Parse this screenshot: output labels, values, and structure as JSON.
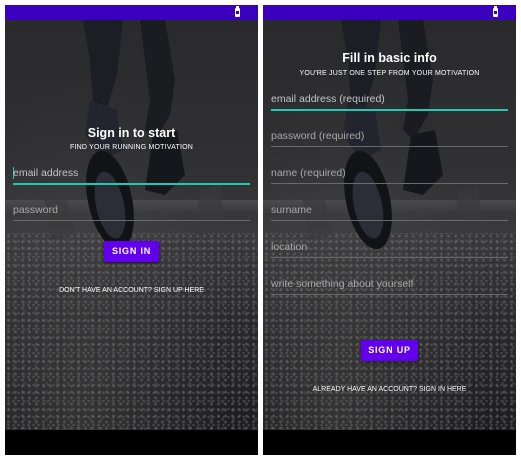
{
  "colors": {
    "status_bar": "#3a00bd",
    "primary_button": "#6200ee",
    "field_focus_underline": "#1fc9b6"
  },
  "signin": {
    "title": "Sign in to start",
    "subtitle": "FIND YOUR RUNNING MOTIVATION",
    "email_placeholder": "email address",
    "password_placeholder": "password",
    "button_label": "SIGN IN",
    "signup_link": "DON'T HAVE AN ACCOUNT? SIGN UP HERE"
  },
  "signup": {
    "title": "Fill in basic info",
    "subtitle": "YOU'RE JUST ONE STEP FROM YOUR MOTIVATION",
    "fields": [
      "email address (required)",
      "password (required)",
      "name (required)",
      "surname",
      "location",
      "write something about yourself"
    ],
    "button_label": "SIGN UP",
    "signin_link": "ALREADY HAVE AN ACCOUNT? SIGN IN HERE"
  }
}
